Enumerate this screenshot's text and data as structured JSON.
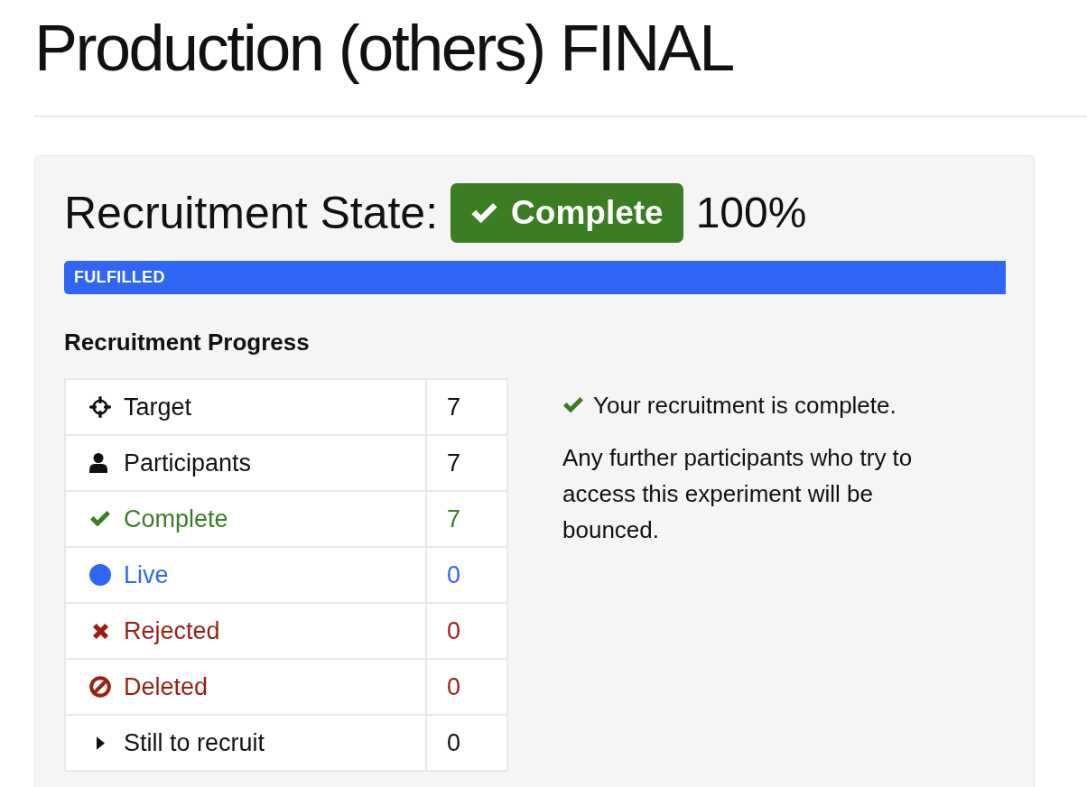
{
  "page": {
    "title": "Production (others) FINAL"
  },
  "recruitment_state": {
    "heading": "Recruitment State:",
    "badge": {
      "label": "Complete",
      "kind": "complete"
    },
    "percent": "100%"
  },
  "progress": {
    "label": "FULFILLED",
    "level": 1
  },
  "progress_table": {
    "title": "Recruitment Progress",
    "rows": [
      {
        "kind": "target",
        "label": "Target",
        "value": "7",
        "color": "#111111"
      },
      {
        "kind": "participants",
        "label": "Participants",
        "value": "7",
        "color": "#111111"
      },
      {
        "kind": "complete",
        "label": "Complete",
        "value": "7",
        "color": "#3b7d23"
      },
      {
        "kind": "live",
        "label": "Live",
        "value": "0",
        "color": "#2f66f5"
      },
      {
        "kind": "rejected",
        "label": "Rejected",
        "value": "0",
        "color": "#9a1f12"
      },
      {
        "kind": "deleted",
        "label": "Deleted",
        "value": "0",
        "color": "#9a1f12"
      },
      {
        "kind": "remaining",
        "label": "Still to recruit",
        "value": "0",
        "color": "#111111"
      }
    ]
  },
  "message": {
    "kind": "complete",
    "headline": "Your recruitment is complete.",
    "text": "Any further participants who try to access this experiment will be bounced."
  }
}
